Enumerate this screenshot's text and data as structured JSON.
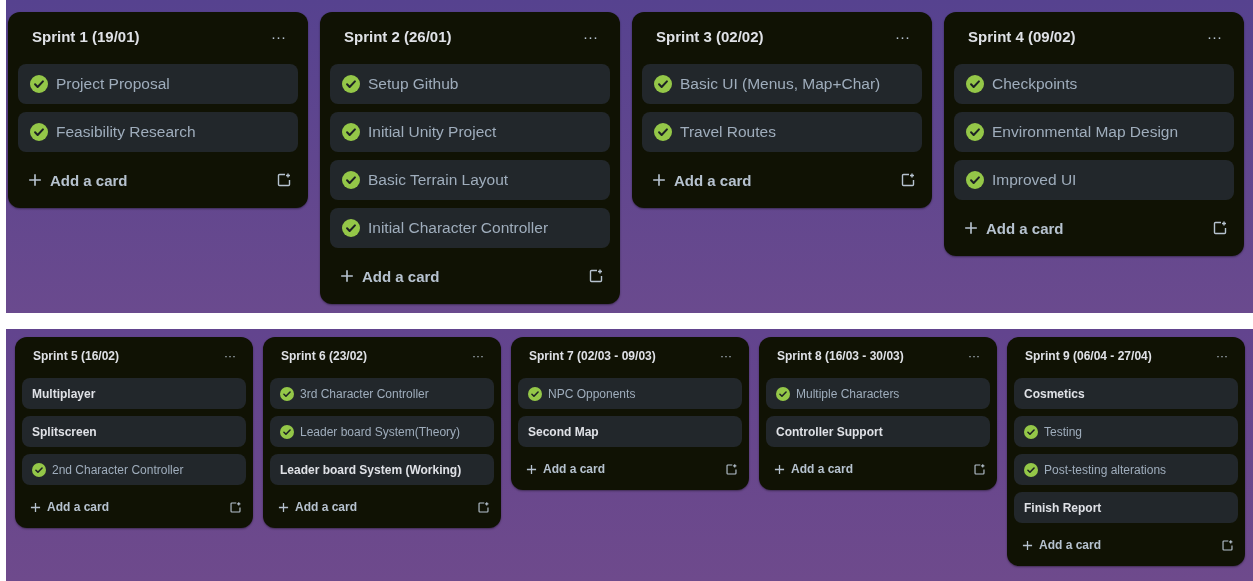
{
  "boards": [
    {
      "lists": [
        {
          "title": "Sprint 1 (19/01)",
          "menu": "···",
          "add_label": "Add a card",
          "cards": [
            {
              "text": "Project Proposal",
              "done": true
            },
            {
              "text": "Feasibility Research",
              "done": true
            }
          ]
        },
        {
          "title": "Sprint 2 (26/01)",
          "menu": "···",
          "add_label": "Add a card",
          "cards": [
            {
              "text": "Setup Github",
              "done": true
            },
            {
              "text": "Initial Unity Project",
              "done": true
            },
            {
              "text": "Basic Terrain Layout",
              "done": true
            },
            {
              "text": "Initial Character Controller",
              "done": true
            }
          ]
        },
        {
          "title": "Sprint 3 (02/02)",
          "menu": "···",
          "add_label": "Add a card",
          "cards": [
            {
              "text": "Basic UI (Menus, Map+Char)",
              "done": true
            },
            {
              "text": "Travel Routes",
              "done": true
            }
          ]
        },
        {
          "title": "Sprint 4 (09/02)",
          "menu": "···",
          "add_label": "Add a card",
          "cards": [
            {
              "text": "Checkpoints",
              "done": true
            },
            {
              "text": "Environmental Map Design",
              "done": true
            },
            {
              "text": "Improved UI",
              "done": true
            }
          ]
        }
      ]
    },
    {
      "lists": [
        {
          "title": "Sprint 5 (16/02)",
          "menu": "···",
          "add_label": "Add a card",
          "cards": [
            {
              "text": "Multiplayer",
              "done": false
            },
            {
              "text": "Splitscreen",
              "done": false
            },
            {
              "text": "2nd Character Controller",
              "done": true
            }
          ]
        },
        {
          "title": "Sprint 6 (23/02)",
          "menu": "···",
          "add_label": "Add a card",
          "cards": [
            {
              "text": "3rd Character Controller",
              "done": true
            },
            {
              "text": "Leader board System(Theory)",
              "done": true
            },
            {
              "text": "Leader board System (Working)",
              "done": false
            }
          ]
        },
        {
          "title": "Sprint 7 (02/03 - 09/03)",
          "menu": "···",
          "add_label": "Add a card",
          "cards": [
            {
              "text": "NPC Opponents",
              "done": true
            },
            {
              "text": "Second Map",
              "done": false
            }
          ]
        },
        {
          "title": "Sprint 8 (16/03 - 30/03)",
          "menu": "···",
          "add_label": "Add a card",
          "cards": [
            {
              "text": "Multiple Characters",
              "done": true
            },
            {
              "text": "Controller Support",
              "done": false
            }
          ]
        },
        {
          "title": "Sprint 9 (06/04 - 27/04)",
          "menu": "···",
          "add_label": "Add a card",
          "cards": [
            {
              "text": "Cosmetics",
              "done": false
            },
            {
              "text": "Testing",
              "done": true
            },
            {
              "text": "Post-testing alterations",
              "done": true
            },
            {
              "text": "Finish Report",
              "done": false
            }
          ]
        }
      ]
    }
  ]
}
